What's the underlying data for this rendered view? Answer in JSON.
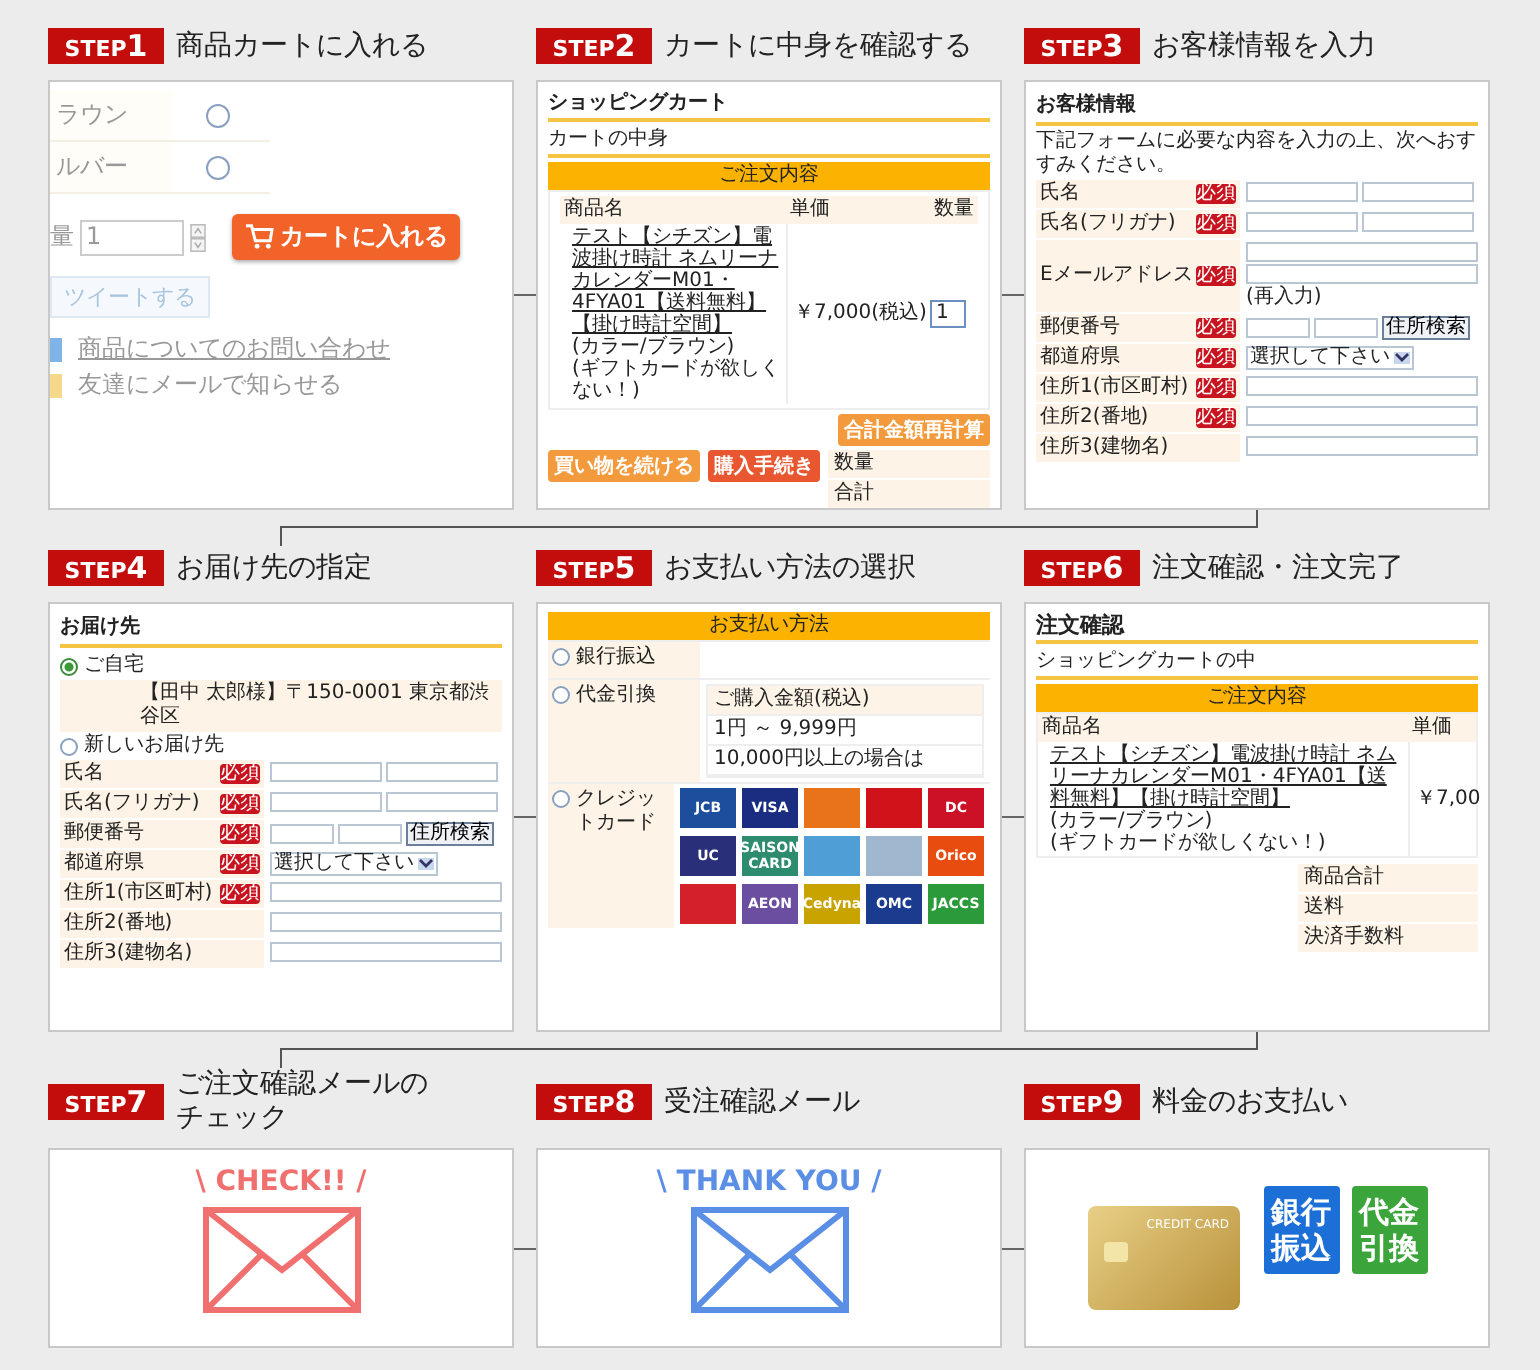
{
  "steps": [
    {
      "badge": "STEP",
      "number": "1",
      "title": "商品カートに入れる",
      "kind": "product",
      "screen": {
        "options": [
          {
            "label": "ラウン",
            "selected": false
          },
          {
            "label": "ルバー",
            "selected": false
          }
        ],
        "quantity_label": "量",
        "quantity": "1",
        "cart_button": "カートに入れる",
        "tweet_button": "ツイートする",
        "links": [
          "商品についてのお問い合わせ",
          "友達にメールで知らせる"
        ]
      }
    },
    {
      "badge": "STEP",
      "number": "2",
      "title": "カートに中身を確認する",
      "kind": "cart",
      "screen": {
        "title": "ショッピングカート",
        "subtitle": "カートの中身",
        "table_title": "ご注文内容",
        "columns": [
          "商品名",
          "単価",
          "数量"
        ],
        "item_link": "テスト【シチズン】電波掛け時計 ネムリーナカレンダーM01・4FYA01【送料無料】【掛け時計空間】",
        "item_notes": [
          "(カラー/ブラウン)",
          "(ギフトカードが欲しくない！)"
        ],
        "price": "￥7,000(税込)",
        "quantity": "1",
        "recalc_button": "合計金額再計算",
        "continue_button": "買い物を続ける",
        "checkout_button": "購入手続き",
        "summary": [
          "数量",
          "合計"
        ]
      }
    },
    {
      "badge": "STEP",
      "number": "3",
      "title": "お客様情報を入力",
      "kind": "form",
      "screen": {
        "title": "お客様情報",
        "intro": "下記フォームに必要な内容を入力の上、次へおすすみください。",
        "rows": [
          {
            "label": "氏名",
            "required": true,
            "badge": "必須",
            "kind": "pair"
          },
          {
            "label": "氏名(フリガナ)",
            "required": true,
            "badge": "必須",
            "kind": "pair"
          },
          {
            "label": "Eメールアドレス",
            "required": true,
            "badge": "必須",
            "kind": "email",
            "note": "(再入力)"
          },
          {
            "label": "郵便番号",
            "required": true,
            "badge": "必須",
            "kind": "zip",
            "button": "住所検索"
          },
          {
            "label": "都道府県",
            "required": true,
            "badge": "必須",
            "kind": "select",
            "value": "選択して下さい"
          },
          {
            "label": "住所1(市区町村)",
            "required": true,
            "badge": "必須",
            "kind": "text"
          },
          {
            "label": "住所2(番地)",
            "required": true,
            "badge": "必須",
            "kind": "text"
          },
          {
            "label": "住所3(建物名)",
            "required": false,
            "kind": "text"
          }
        ]
      }
    },
    {
      "badge": "STEP",
      "number": "4",
      "title": "お届け先の指定",
      "kind": "delivery",
      "screen": {
        "title": "お届け先",
        "choices": [
          {
            "label": "ご自宅",
            "selected": true
          },
          {
            "label": "新しいお届け先",
            "selected": false
          }
        ],
        "address": "【田中 太郎様】〒150-0001 東京都渋谷区",
        "rows": [
          {
            "label": "氏名",
            "required": true,
            "badge": "必須",
            "kind": "pair"
          },
          {
            "label": "氏名(フリガナ)",
            "required": true,
            "badge": "必須",
            "kind": "pair"
          },
          {
            "label": "郵便番号",
            "required": true,
            "badge": "必須",
            "kind": "zip",
            "button": "住所検索"
          },
          {
            "label": "都道府県",
            "required": true,
            "badge": "必須",
            "kind": "select",
            "value": "選択して下さい"
          },
          {
            "label": "住所1(市区町村)",
            "required": true,
            "badge": "必須",
            "kind": "text"
          },
          {
            "label": "住所2(番地)",
            "required": false,
            "kind": "text"
          },
          {
            "label": "住所3(建物名)",
            "required": false,
            "kind": "text"
          }
        ]
      }
    },
    {
      "badge": "STEP",
      "number": "5",
      "title": "お支払い方法の選択",
      "kind": "payment",
      "screen": {
        "title": "お支払い方法",
        "methods": [
          {
            "label": "銀行振込",
            "selected": false,
            "kind": "plain"
          },
          {
            "label": "代金引換",
            "selected": false,
            "kind": "fees",
            "rows": [
              "ご購入金額(税込)",
              "1円 ～ 9,999円",
              "10,000円以上の場合は"
            ]
          },
          {
            "label": "クレジットカード",
            "selected": false,
            "kind": "cards",
            "cards": [
              {
                "label": "JCB",
                "color": "#1d4e9e"
              },
              {
                "label": "VISA",
                "color": "#1a2d80"
              },
              {
                "color": "#e8731a"
              },
              {
                "color": "#d0121b"
              },
              {
                "label": "DC",
                "color": "#cc1126"
              },
              {
                "label": "UC",
                "color": "#2a2f7a"
              },
              {
                "label": "SAISON CARD",
                "color": "#2e8c6e"
              },
              {
                "color": "#4f9fd6"
              },
              {
                "color": "#9fb7cf"
              },
              {
                "label": "Orico",
                "color": "#e84c0e"
              },
              {
                "color": "#d3202a"
              },
              {
                "label": "AEON",
                "color": "#6b4ea0"
              },
              {
                "label": "Cedyna",
                "color": "#c9a400"
              },
              {
                "label": "OMC",
                "color": "#1b3c8e"
              },
              {
                "label": "JACCS",
                "color": "#2a9a3a"
              }
            ]
          }
        ]
      }
    },
    {
      "badge": "STEP",
      "number": "6",
      "title": "注文確認・注文完了",
      "kind": "confirm",
      "screen": {
        "title": "注文確認",
        "subtitle": "ショッピングカートの中",
        "table_title": "ご注文内容",
        "columns": [
          "商品名",
          "単価"
        ],
        "item_link": "テスト【シチズン】電波掛け時計 ネムリーナカレンダーM01・4FYA01【送料無料】【掛け時計空間】",
        "item_notes": [
          "(カラー/ブラウン)",
          "(ギフトカードが欲しくない！)"
        ],
        "price": "￥7,00",
        "summary": [
          "商品合計",
          "送料",
          "決済手数料"
        ]
      }
    },
    {
      "badge": "STEP",
      "number": "7",
      "title": "ご注文確認メールの",
      "title_2": "チェック",
      "kind": "mail",
      "screen": {
        "caption": "\\ CHECK!! /",
        "color": "#f07070"
      }
    },
    {
      "badge": "STEP",
      "number": "8",
      "title": "受注確認メール",
      "kind": "mail",
      "screen": {
        "caption": "\\ THANK YOU /",
        "color": "#5b8fe6"
      }
    },
    {
      "badge": "STEP",
      "number": "9",
      "title": "料金のお支払い",
      "kind": "payment_icons",
      "screen": {
        "card_text": "CREDIT CARD",
        "tiles": [
          {
            "label": "銀行振込",
            "color": "#1c6fd6"
          },
          {
            "label": "代金引換",
            "color": "#3ba53b"
          }
        ]
      }
    }
  ]
}
